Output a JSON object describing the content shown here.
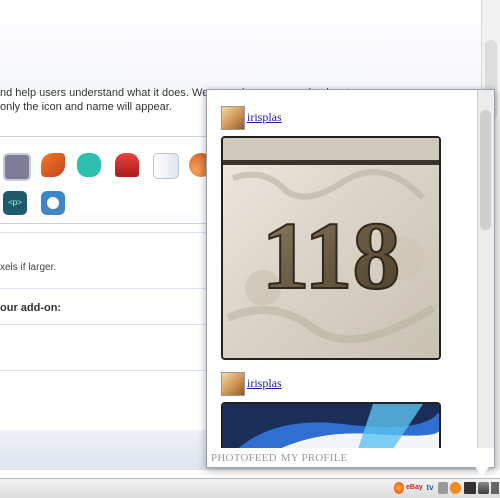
{
  "page": {
    "description_line1": "nd help users understand what it does. We strongly recommend at least",
    "description_line2": " only the icon and name will appear.",
    "size_note": "xels if larger.",
    "addon_label": "our add-on:"
  },
  "popup": {
    "posts": [
      {
        "username": "irisplas",
        "photo_text": "118"
      },
      {
        "username": "irisplas"
      }
    ],
    "footer": {
      "photofeed": "PHOTOFEED",
      "my_profile": "MY PROFILE"
    }
  },
  "statusbar": {
    "icons": [
      "ebay-icon",
      "tv-icon",
      "feed-icon",
      "photofeed-icon",
      "window-icon"
    ],
    "ebay_label": "eBay",
    "tv_label": "tv"
  },
  "colors": {
    "link": "#1a1aa6",
    "footer_text": "#9a9a9a",
    "panel_border": "#c9d3e2"
  }
}
